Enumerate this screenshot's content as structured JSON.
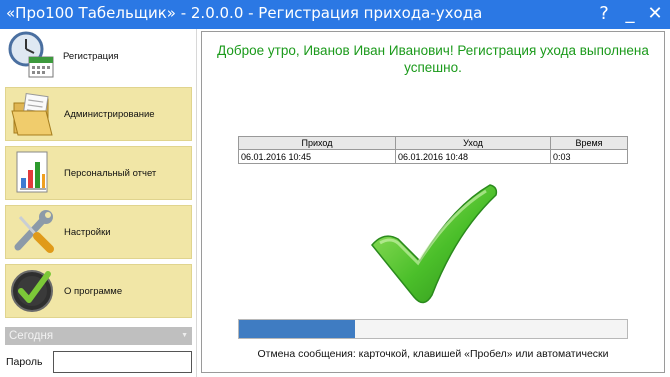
{
  "window": {
    "title": "«Про100 Табельщик» - 2.0.0.0 - Регистрация прихода-ухода",
    "help": "?",
    "minimize": "_",
    "close": "✕"
  },
  "sidebar": {
    "items": [
      {
        "label": "Регистрация",
        "icon": "clock-calendar-icon"
      },
      {
        "label": "Администрирование",
        "icon": "folder-documents-icon"
      },
      {
        "label": "Персональный отчет",
        "icon": "bar-chart-report-icon"
      },
      {
        "label": "Настройки",
        "icon": "wrench-screwdriver-icon"
      },
      {
        "label": "О программе",
        "icon": "check-circle-icon"
      }
    ],
    "period_select": {
      "value": "Сегодня"
    },
    "password": {
      "label": "Пароль",
      "value": ""
    }
  },
  "main": {
    "message": "Доброе утро, Иванов Иван Иванович! Регистрация ухода выполнена успешно.",
    "table": {
      "headers": [
        "Приход",
        "Уход",
        "Время"
      ],
      "rows": [
        [
          "06.01.2016 10:45",
          "06.01.2016 10:48",
          "0:03"
        ]
      ]
    },
    "progress": 0.3,
    "hint": "Отмена сообщения: карточкой, клавишей «Пробел» или автоматически"
  },
  "colors": {
    "titlebar": "#2b78e4",
    "nav_item": "#f1e6a6",
    "success_text": "#1b9a1b",
    "progress_fill": "#3f7cc2"
  }
}
